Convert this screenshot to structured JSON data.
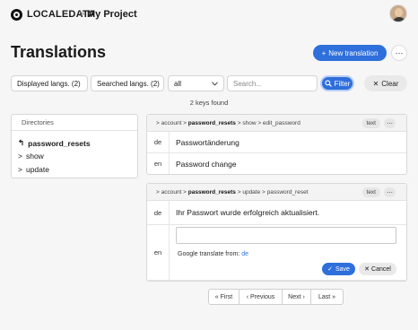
{
  "header": {
    "brand": "LOCALEDATA",
    "separator": ">",
    "project": "My Project"
  },
  "page": {
    "title": "Translations",
    "new_button": "New translation",
    "more_icon": "⋯"
  },
  "filters": {
    "displayed_langs": "Displayed langs. (2)",
    "searched_langs": "Searched langs. (2)",
    "scope_value": "all",
    "search_placeholder": "Search...",
    "filter_button": "Filter",
    "clear_button": "Clear"
  },
  "results": {
    "count_text": "2 keys found"
  },
  "directories": {
    "header": "Directories",
    "items": [
      {
        "label": "password_resets",
        "icon": "↰",
        "active": true
      },
      {
        "label": "show",
        "icon": ">",
        "active": false
      },
      {
        "label": "update",
        "icon": ">",
        "active": false
      }
    ]
  },
  "keys": [
    {
      "path_prefix": "> account >",
      "path_bold": "password_resets",
      "path_suffix": "> show > edit_password",
      "type_tag": "text",
      "translations": [
        {
          "lang": "de",
          "value": "Passwortänderung"
        },
        {
          "lang": "en",
          "value": "Password change"
        }
      ]
    },
    {
      "path_prefix": "> account >",
      "path_bold": "password_resets",
      "path_suffix": "> update > password_reset",
      "type_tag": "text",
      "translations": [
        {
          "lang": "de",
          "value": "Ihr Passwort wurde erfolgreich aktualisiert."
        },
        {
          "lang": "en",
          "value": ""
        }
      ],
      "editor": {
        "google_translate_label": "Google translate from:",
        "google_translate_lang": "de",
        "save_button": "Save",
        "cancel_button": "Cancel"
      }
    }
  ],
  "pagination": {
    "first": "« First",
    "previous": "‹ Previous",
    "next": "Next ›",
    "last": "Last »"
  },
  "colors": {
    "accent": "#2f6fdb",
    "background": "#f6f6f6"
  }
}
